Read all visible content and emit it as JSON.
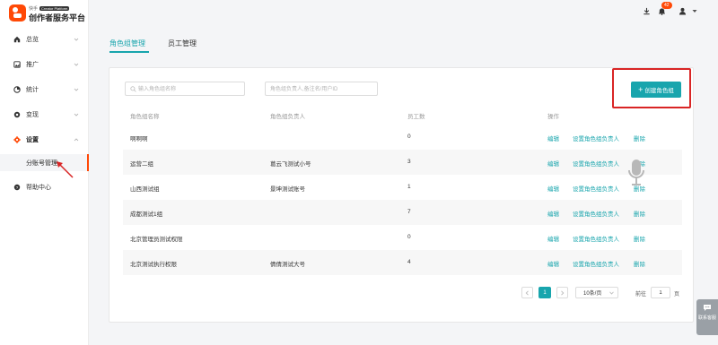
{
  "brand": {
    "small_text": "快手",
    "tag": "Creator Platform",
    "name": "创作者服务平台",
    "color": "#ff4906"
  },
  "sidebar": {
    "items": [
      {
        "label": "总览",
        "icon": "home-icon"
      },
      {
        "label": "推广",
        "icon": "image-icon"
      },
      {
        "label": "统计",
        "icon": "chart-icon"
      },
      {
        "label": "变现",
        "icon": "coin-icon"
      },
      {
        "label": "设置",
        "icon": "gear-icon",
        "active": true
      },
      {
        "label": "帮助中心",
        "icon": "question-icon"
      }
    ],
    "sub_item": "分账号管理"
  },
  "topbar": {
    "notification_count": "42"
  },
  "tabs": [
    {
      "label": "角色组管理",
      "active": true
    },
    {
      "label": "员工管理",
      "active": false
    }
  ],
  "filters": {
    "search1_placeholder": "输入角色组名称",
    "search2_placeholder": "角色组负责人,备注名/用户ID"
  },
  "create_button": {
    "label": "创建角色组"
  },
  "table": {
    "headers": [
      "角色组名称",
      "角色组负责人",
      "员工数",
      "操作"
    ],
    "rows": [
      {
        "name": "啊啊啊",
        "owner": "",
        "count": "0"
      },
      {
        "name": "运营二组",
        "owner": "葛云飞测试小号",
        "count": "3"
      },
      {
        "name": "山西测试组",
        "owner": "景坤测试账号",
        "count": "1"
      },
      {
        "name": "成都测试1组",
        "owner": "",
        "count": "7"
      },
      {
        "name": "北京管理员测试权限",
        "owner": "",
        "count": "0"
      },
      {
        "name": "北京测试执行权限",
        "owner": "倩倩测试大号",
        "count": "4"
      }
    ],
    "actions": [
      "编辑",
      "设置角色组负责人",
      "删除"
    ]
  },
  "pagination": {
    "current": "1",
    "page_size": "10条/页",
    "goto_label": "前往",
    "goto_value": "1",
    "page_suffix": "页"
  },
  "help_widget": {
    "label": "联系客服"
  },
  "colors": {
    "accent": "#18a5ad",
    "highlight": "#d92525"
  }
}
